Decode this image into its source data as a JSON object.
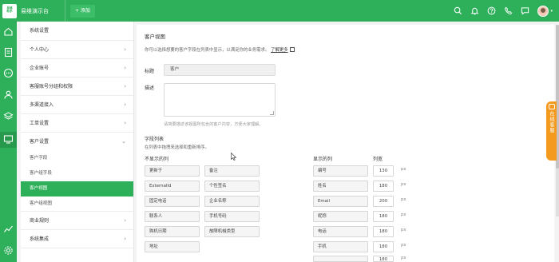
{
  "topbar": {
    "logo_text": "易维\n助手",
    "app_name": "易维演示台",
    "add_label": "+ 添加",
    "icons": [
      "search-icon",
      "bell-icon",
      "help-icon",
      "phone-icon",
      "chat-icon",
      "avatar"
    ]
  },
  "rail": {
    "icons": [
      "home-icon",
      "ticket-icon",
      "chat-bubble-icon",
      "contacts-icon",
      "layers-icon",
      "monitor-icon",
      "stats-icon",
      "settings-icon"
    ]
  },
  "sidebar": {
    "title": "系统设置",
    "items": [
      {
        "label": "个人中心",
        "arrow": "›"
      },
      {
        "label": "企业账号",
        "arrow": "›"
      },
      {
        "label": "客服账号分组和权限",
        "arrow": "›"
      },
      {
        "label": "多渠道接入",
        "arrow": "›"
      },
      {
        "label": "工单设置",
        "arrow": "›"
      },
      {
        "label": "客户设置",
        "arrow": "⌄"
      }
    ],
    "sub_items": [
      "客户字段",
      "客户组字段",
      "客户视图",
      "客户组视图"
    ],
    "items_after": [
      {
        "label": "商业规则",
        "arrow": "›"
      },
      {
        "label": "系统集成",
        "arrow": "›"
      }
    ]
  },
  "main": {
    "heading": "客户视图",
    "description": "你可以选择想要的客户字段在列表中显示，以满足你的业务需求。",
    "learn_more": "了解更多",
    "title_label": "标题",
    "title_value": "客户",
    "desc_label": "描述",
    "desc_hint": "请简要描述该视图所包含的客户内容，方便大家理解。",
    "fields_heading": "字段列表",
    "fields_sub": "在列表中拖拽来选择和重新排序。",
    "hidden_heading": "不显示的列",
    "hidden_fields": [
      "更新于",
      "备注",
      "ExternalId",
      "个性签名",
      "固定电话",
      "企业名称",
      "联系人",
      "手机号码",
      "购机日期",
      "故障机械类型",
      "地址"
    ],
    "shown_heading": "显示的列",
    "width_heading": "列宽",
    "shown_fields": [
      {
        "name": "编号",
        "width": "130"
      },
      {
        "name": "姓名",
        "width": "180"
      },
      {
        "name": "Email",
        "width": "200"
      },
      {
        "name": "昵称",
        "width": "180"
      },
      {
        "name": "电话",
        "width": "180"
      },
      {
        "name": "手机",
        "width": "180"
      },
      {
        "name": "",
        "width": "180"
      }
    ],
    "unit": "px"
  },
  "float_help": {
    "label": "在线客服"
  }
}
